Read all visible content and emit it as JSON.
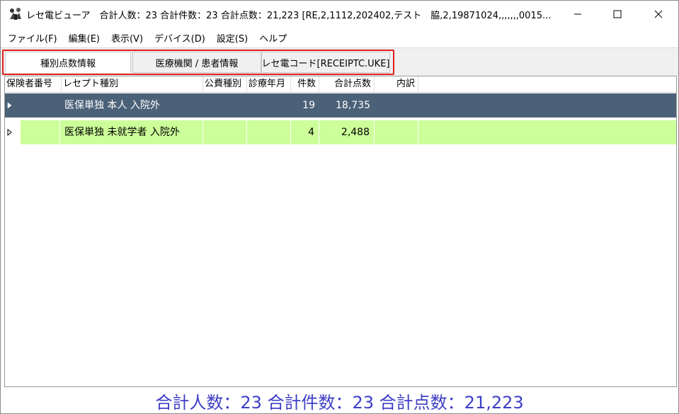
{
  "window": {
    "title": "レセ電ビューア　合計人数：23 合計件数：23 合計点数：21,223 [RE,2,1112,202402,テスト　脇,2,19871024,,,,,,,0015..."
  },
  "menu": {
    "items": [
      "ファイル(F)",
      "編集(E)",
      "表示(V)",
      "デバイス(D)",
      "設定(S)",
      "ヘルプ"
    ]
  },
  "tabs": {
    "items": [
      "種別点数情報",
      "医療機関 / 患者情報",
      "レセ電コード[RECEIPTC.UKE]"
    ],
    "active_index": 0,
    "highlight_color": "#e0201e"
  },
  "grid": {
    "columns": [
      "保険者番号",
      "レセプト種別",
      "公費種別",
      "診療年月",
      "件数",
      "合計点数",
      "内訳"
    ],
    "rows": [
      {
        "type": "医保単独 本人 入院外",
        "count": "19",
        "points": "18,735",
        "selected": true
      },
      {
        "type": "医保単独 未就学者 入院外",
        "count": "4",
        "points": "2,488",
        "selected": false
      }
    ],
    "selected_row_color": "#4b6178",
    "alt_row_color": "#ccff99"
  },
  "footer": {
    "summary": "合計人数：23  合計件数：23  合計点数：21,223",
    "color": "#3d3fc4"
  }
}
